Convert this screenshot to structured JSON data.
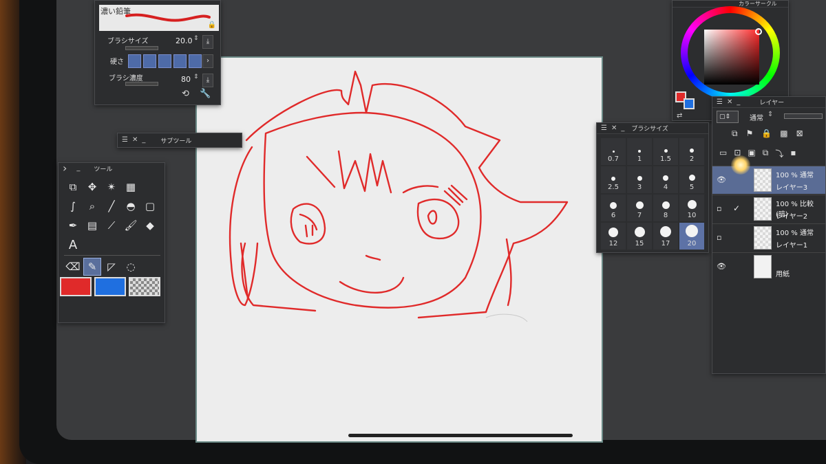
{
  "brush_property": {
    "brush_name": "濃い鉛筆",
    "size_label": "ブラシサイズ",
    "size_value": "20.0",
    "hardness_label": "硬さ",
    "density_label": "ブラシ濃度",
    "density_value": "80"
  },
  "sub_tool": {
    "title": "サブツール"
  },
  "tool_panel": {
    "title": "ツール",
    "tools": [
      "move-layer-icon",
      "move-icon",
      "magic-wand-icon",
      "grid-icon",
      "sparkle-icon",
      "pen-nib-icon",
      "zoom-icon",
      "line-icon",
      "blend-icon",
      "rect-select-icon",
      "pen-icon",
      "gradient-icon",
      "eyedropper-icon",
      "brush-icon",
      "fill-icon",
      "text-icon",
      "eraser-icon",
      "pencil-icon",
      "ruler-icon",
      "lasso-icon"
    ],
    "text_tool_glyph": "A",
    "main_color": "#e02a2a",
    "sub_color": "#1f6fe0"
  },
  "brush_size": {
    "title": "ブラシサイズ",
    "sizes": [
      "0.7",
      "1",
      "1.5",
      "2",
      "2.5",
      "3",
      "4",
      "5",
      "6",
      "7",
      "8",
      "10",
      "12",
      "15",
      "17",
      "20"
    ],
    "selected": "20"
  },
  "color_wheel": {
    "title": "カラーサークル",
    "main_color": "#e02a2a",
    "sub_color": "#1f6fe0"
  },
  "layer_panel": {
    "title": "レイヤー",
    "blend_mode": "通常",
    "layers": [
      {
        "opacity": "100 %",
        "mode": "通常",
        "name": "レイヤー3",
        "visible": true,
        "selected": true
      },
      {
        "opacity": "100 %",
        "mode": "比較(暗)",
        "name": "レイヤー2",
        "visible": false,
        "selected": false
      },
      {
        "opacity": "100 %",
        "mode": "通常",
        "name": "レイヤー1",
        "visible": false,
        "selected": false
      },
      {
        "opacity": "",
        "mode": "",
        "name": "用紙",
        "visible": true,
        "selected": false
      }
    ]
  },
  "canvas": {
    "stroke_color": "#e02a2a"
  }
}
